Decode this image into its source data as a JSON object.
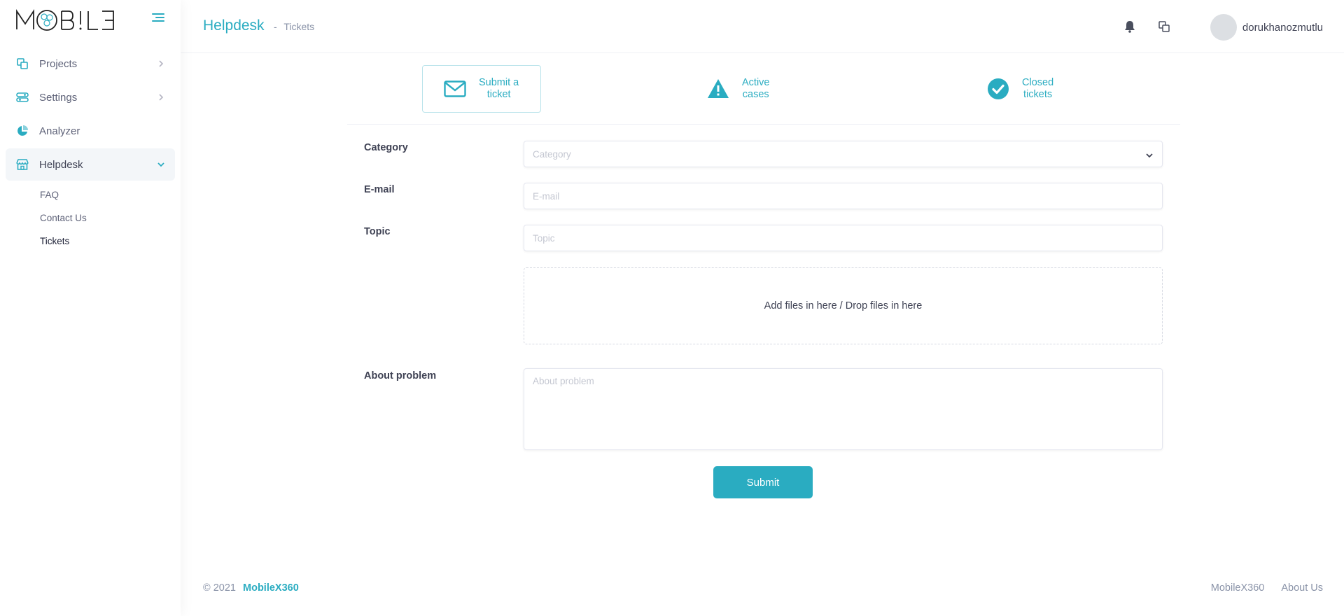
{
  "brand": {
    "logo_text": "MOBIL3"
  },
  "colors": {
    "accent": "#2aacc1",
    "text": "#3f4254",
    "muted": "#8a93a8"
  },
  "sidebar": {
    "items": [
      {
        "label": "Projects",
        "icon": "projects-icon"
      },
      {
        "label": "Settings",
        "icon": "settings-icon"
      },
      {
        "label": "Analyzer",
        "icon": "pie-chart-icon"
      },
      {
        "label": "Helpdesk",
        "icon": "helpdesk-icon"
      }
    ],
    "submenu": [
      {
        "label": "FAQ"
      },
      {
        "label": "Contact Us"
      },
      {
        "label": "Tickets"
      }
    ]
  },
  "header": {
    "title": "Helpdesk",
    "breadcrumb_sep": "-",
    "breadcrumb": "Tickets",
    "username": "dorukhanozmutlu"
  },
  "tabs": [
    {
      "line1": "Submit a",
      "line2": "ticket",
      "icon": "envelope-icon"
    },
    {
      "line1": "Active",
      "line2": "cases",
      "icon": "warning-icon"
    },
    {
      "line1": "Closed",
      "line2": "tickets",
      "icon": "check-circle-icon"
    }
  ],
  "form": {
    "category_label": "Category",
    "category_placeholder": "Category",
    "email_label": "E-mail",
    "email_placeholder": "E-mail",
    "topic_label": "Topic",
    "topic_placeholder": "Topic",
    "dropzone_text": "Add files in here / Drop files in here",
    "about_label": "About problem",
    "about_placeholder": "About problem",
    "submit_label": "Submit"
  },
  "footer": {
    "copyright": "© 2021",
    "brand": "MobileX360",
    "links": [
      "MobileX360",
      "About Us"
    ]
  }
}
